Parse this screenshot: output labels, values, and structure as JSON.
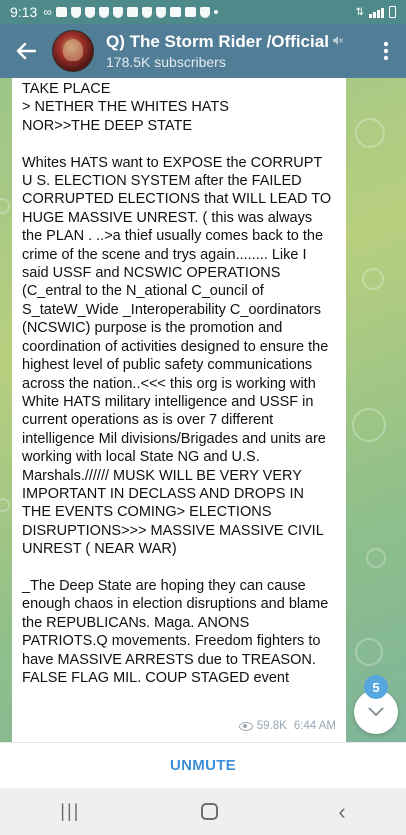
{
  "status_bar": {
    "time": "9:13"
  },
  "header": {
    "title": "Q) The Storm Rider /Official",
    "subscribers": "178.5K subscribers"
  },
  "message": {
    "text": "TAKE PLACE\n> NETHER THE WHITES HATS\nNOR>>THE DEEP STATE\n\nWhites HATS want to EXPOSE the CORRUPT U S. ELECTION SYSTEM after the FAILED CORRUPTED ELECTIONS that WILL LEAD TO HUGE MASSIVE UNREST. ( this was always the PLAN . ..>a thief usually comes back to the crime of the scene and trys again........ Like I said USSF and NCSWIC OPERATIONS  (C_entral to the N_ational C_ouncil of S_tateW_Wide _Interoperability C_oordinators (NCSWIC) purpose is the promotion and coordination of activities designed to ensure the highest level of public safety communications across the nation..<<< this org is working with White HATS military intelligence and USSF in current operations as is over 7 different intelligence Mil divisions/Brigades and units are working with local State NG and U.S. Marshals.////// MUSK WILL BE VERY VERY IMPORTANT IN DECLASS AND DROPS IN THE EVENTS COMING> ELECTIONS DISRUPTIONS>>> MASSIVE MASSIVE CIVIL UNREST ( NEAR WAR)\n\n_The Deep State are hoping they can cause enough chaos in election disruptions and blame the REPUBLICANs. Maga. ANONS PATRIOTS.Q movements. Freedom fighters to have MASSIVE ARRESTS due to TREASON. FALSE FLAG MIL. COUP STAGED event",
    "views": "59.8K",
    "time": "6:44 AM"
  },
  "unread_count": "5",
  "bottom": {
    "unmute_label": "UNMUTE"
  },
  "icons": {
    "back": "arrow-left-icon",
    "more": "more-vert-icon",
    "muted": "muted-speaker-icon",
    "views": "eye-icon",
    "scroll": "chevron-down-icon"
  },
  "colors": {
    "header": "#527d96",
    "status_bar": "#4f8a8b",
    "accent": "#3c8fd6",
    "badge": "#56a6e0"
  }
}
